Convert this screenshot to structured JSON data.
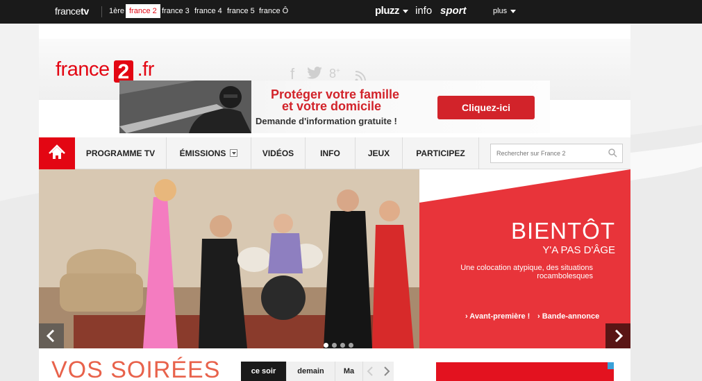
{
  "topbar": {
    "brand_light": "france",
    "brand_bold": "tv",
    "channels": [
      {
        "label": "1ère",
        "active": false
      },
      {
        "label": "france 2",
        "active": true
      },
      {
        "label": "france 3",
        "active": false
      },
      {
        "label": "france 4",
        "active": false
      },
      {
        "label": "france 5",
        "active": false
      },
      {
        "label": "france Ô",
        "active": false
      }
    ],
    "pluzz": "pluzz",
    "info": "info",
    "sport": "sport",
    "plus": "plus"
  },
  "header": {
    "logo_prefix": "france",
    "logo_number": "2",
    "logo_suffix": ".fr",
    "social": [
      "facebook-icon",
      "twitter-icon",
      "google-plus-icon",
      "rss-icon"
    ]
  },
  "banner": {
    "line1": "Protéger votre famille",
    "line2": "et votre domicile",
    "line3": "Demande d'information gratuite !",
    "cta": "Cliquez-ici"
  },
  "nav": {
    "items": [
      "PROGRAMME TV",
      "ÉMISSIONS",
      "VIDÉOS",
      "INFO",
      "JEUX",
      "PARTICIPEZ"
    ],
    "search_placeholder": "Rechercher sur France 2"
  },
  "hero": {
    "title": "BIENTÔT",
    "subtitle": "Y'A PAS D'ÂGE",
    "description": "Une colocation atypique, des situations rocambolesques",
    "link1": "› Avant-première !",
    "link2": "› Bande-annonce",
    "slide_count": 4,
    "active_slide": 0
  },
  "soirees": {
    "title": "VOS SOIRÉES",
    "tabs": [
      "ce soir",
      "demain",
      "Ma"
    ],
    "active_tab": 0
  },
  "colors": {
    "brand_red": "#e30613",
    "hero_red": "#e8343a",
    "top_bar": "#1a1a1a"
  }
}
